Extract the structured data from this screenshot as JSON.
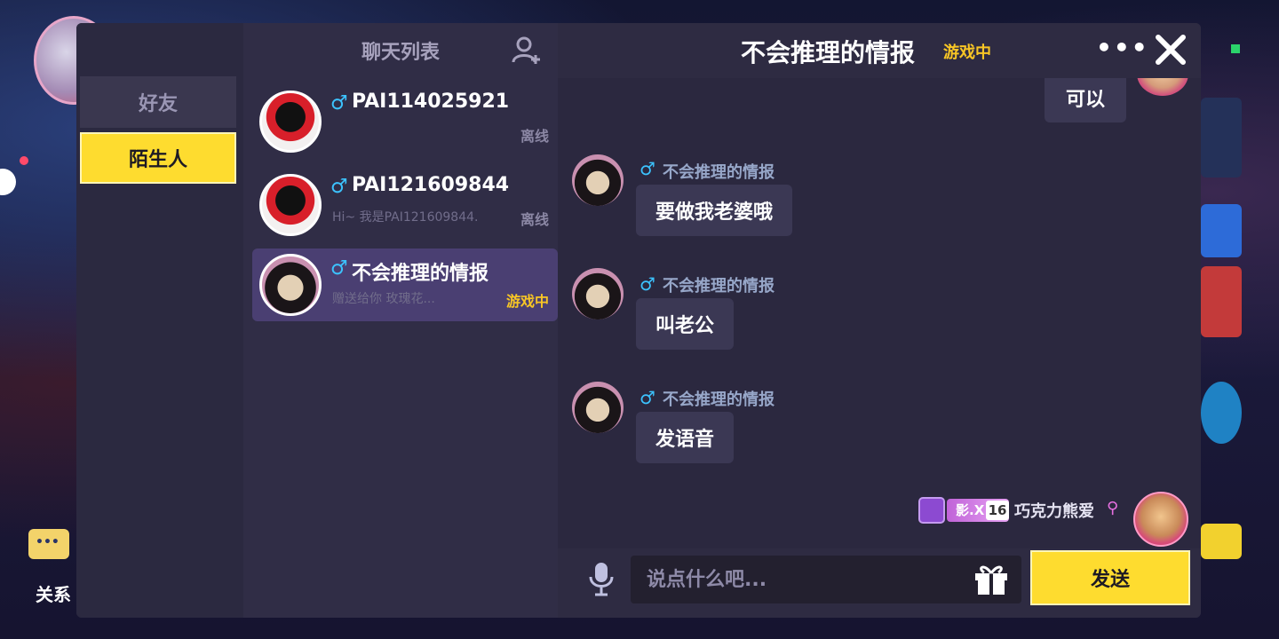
{
  "background": {
    "relation_label": "关系"
  },
  "tabs": [
    {
      "label": "好友",
      "active": false
    },
    {
      "label": "陌生人",
      "active": true
    }
  ],
  "chat_list": {
    "title": "聊天列表",
    "contacts": [
      {
        "name": "PAI114025921",
        "preview": "",
        "status": "离线"
      },
      {
        "name": "PAI121609844",
        "preview": "Hi~ 我是PAI121609844.",
        "status": "离线"
      },
      {
        "name": "不会推理的情报",
        "preview": "赠送给你 玫瑰花...",
        "status": "游戏中"
      }
    ]
  },
  "chat": {
    "title": "不会推理的情报",
    "status": "游戏中",
    "messages": [
      {
        "from_self": true,
        "text": "可以"
      },
      {
        "from_self": false,
        "sender": "不会推理的情报",
        "text": "要做我老婆哦"
      },
      {
        "from_self": false,
        "sender": "不会推理的情报",
        "text": "叫老公"
      },
      {
        "from_self": false,
        "sender": "不会推理的情报",
        "text": "发语音"
      }
    ],
    "self_tag": {
      "tag_text": "影.X",
      "level": "16",
      "name": "巧克力熊爱"
    },
    "input_placeholder": "说点什么吧...",
    "send_label": "发送"
  },
  "colors": {
    "accent_yellow": "#fedc2f",
    "status_ingame": "#f8c625",
    "male_blue": "#3cc3ff"
  }
}
